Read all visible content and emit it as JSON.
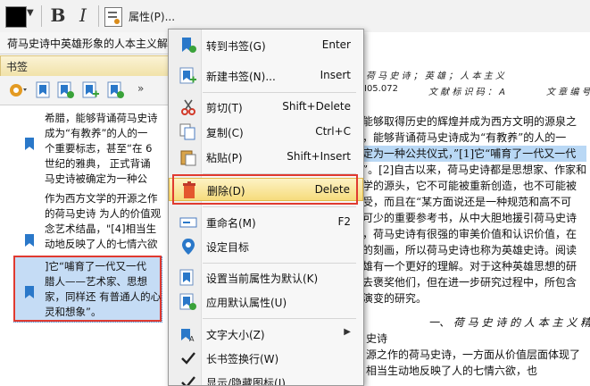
{
  "toolbar": {
    "bold": "B",
    "italic": "I",
    "properties_label": "属性(P)..."
  },
  "title_bar": {
    "title": "荷马史诗中英雄形象的人本主义解"
  },
  "bookmark_panel": {
    "title": "书签",
    "items": [
      {
        "lines": [
          "希腊，能够背诵荷马史诗",
          "成为“有教养”的人的一",
          "个重要标志，甚至“在 6",
          "世纪的雅典， 正式背诵",
          "马史诗被确定为一种公"
        ]
      },
      {
        "lines": [
          "作为西方文学的开源之作",
          "的荷马史诗 为人的价值观",
          "念艺术结晶，\"[4]相当生",
          "动地反映了人的七情六欲"
        ]
      },
      {
        "lines": [
          "]它“哺育了一代又一代",
          "腊人——艺术家、思想",
          "家，同样还 有普通人的心",
          "灵和想象”。"
        ]
      }
    ]
  },
  "document": {
    "header_left": "荷 马 史 诗 ； 英 雄 ； 人 本 主 义",
    "header_code": "I05.072",
    "header_mid": "文 献 标 识 码 ： A",
    "header_right": "文 章 编 号",
    "lines": [
      "能够取得历史的辉煌并成为西方文明的源泉之",
      "，能够背诵荷马史诗成为“有教养”的人的一",
      "定为一种公共仪式，”[1]它“哺育了一代又一代",
      "”。[2]自古以来，荷马史诗都是思想家、作家和",
      "学的源头，它不可能被重新创造，也不可能被",
      "受，而且在“某方面说还是一种规范和高不可",
      "可少的重要参考书，从中大胆地援引荷马史诗",
      "，荷马史诗有很强的审美价值和认识价值，在",
      "的刻画，所以荷马史诗也称为英雄史诗。阅读",
      "雄有一个更好的理解。对于这种英雄思想的研",
      "去褒奖他们，但在进一步研究过程中，所包含",
      "演变的研究。",
      "一、 荷 马 史 诗 的 人 本 主 义 精",
      "史诗",
      "源之作的荷马史诗，一方面从价值层面体现了",
      "相当生动地反映了人的七情六欲，也"
    ]
  },
  "context_menu": {
    "items": [
      {
        "label": "转到书签(G)",
        "shortcut": "Enter"
      },
      {
        "label": "新建书签(N)...",
        "shortcut": "Insert"
      },
      {
        "label": "剪切(T)",
        "shortcut": "Shift+Delete"
      },
      {
        "label": "复制(C)",
        "shortcut": "Ctrl+C"
      },
      {
        "label": "粘贴(P)",
        "shortcut": "Shift+Insert"
      },
      {
        "label": "删除(D)",
        "shortcut": "Delete"
      },
      {
        "label": "重命名(M)",
        "shortcut": "F2"
      },
      {
        "label": "设定目标",
        "shortcut": ""
      },
      {
        "label": "设置当前属性为默认(K)",
        "shortcut": ""
      },
      {
        "label": "应用默认属性(U)",
        "shortcut": ""
      },
      {
        "label": "文字大小(Z)",
        "shortcut": ""
      },
      {
        "label": "长书签换行(W)",
        "shortcut": ""
      },
      {
        "label": "显示/隐藏图标(I)",
        "shortcut": ""
      }
    ]
  },
  "colors": {
    "highlight": "#f6dc7c",
    "annotation_red": "#e03a30",
    "bookmark_blue": "#2a78c9"
  }
}
